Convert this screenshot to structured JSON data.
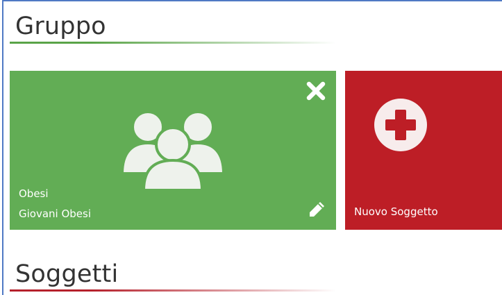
{
  "sections": {
    "group_title": "Gruppo",
    "subjects_title": "Soggetti"
  },
  "group_card": {
    "name": "Obesi",
    "description": "Giovani Obesi",
    "icon": "users-group-icon",
    "color": "#62ad55"
  },
  "new_subject_card": {
    "label": "Nuovo Soggetto",
    "icon": "plus-circle-icon",
    "color": "#bd1e26"
  },
  "colors": {
    "group_accent": "#5aa448",
    "subjects_accent": "#b5202b",
    "frame_border": "#4f79c4",
    "title_text": "#333333"
  }
}
